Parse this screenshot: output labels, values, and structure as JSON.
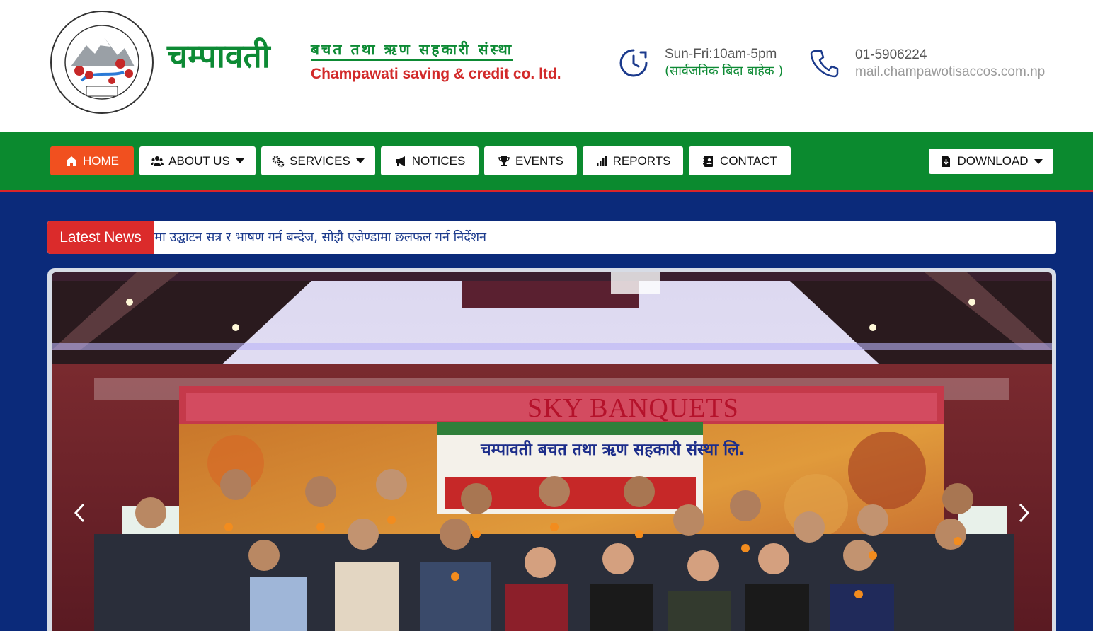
{
  "header": {
    "brand_np": "चम्पावती",
    "brand_sub_np": "बचत तथा ऋण सहकारी संस्था",
    "brand_sub_en": "Champawati saving & credit co. ltd.",
    "logo": {
      "top_text": "चम्पावती बचत तथा ऋण सहकारी संस्था लि.",
      "year": "२०६७",
      "bottom_text": "टोखा-०५, गोंगबु, काठमाडौं"
    },
    "hours_line1": "Sun-Fri:10am-5pm",
    "hours_line2": "(सार्वजनिक बिदा बाहेक )",
    "phone": "01-5906224",
    "email": "mail.champawotisaccos.com.np",
    "icons": [
      "clock-icon",
      "phone-icon"
    ]
  },
  "nav": {
    "items": [
      {
        "label": "HOME",
        "icon": "home-icon"
      },
      {
        "label": "ABOUT US",
        "icon": "users-icon"
      },
      {
        "label": "SERVICES",
        "icon": "gears-icon"
      },
      {
        "label": "NOTICES",
        "icon": "megaphone-icon"
      },
      {
        "label": "EVENTS",
        "icon": "trophy-icon"
      },
      {
        "label": "REPORTS",
        "icon": "chart-icon"
      },
      {
        "label": "CONTACT",
        "icon": "address-book-icon"
      }
    ],
    "download": {
      "label": "DOWNLOAD",
      "icon": "file-download-icon"
    }
  },
  "news": {
    "label": "Latest News",
    "text": "ामा उद्घाटन सत्र र भाषण गर्न बन्देज, सोझै एजेण्डामा छलफल गर्न निर्देशन"
  },
  "slider": {
    "venue_text": "SKY BANQUETS",
    "banner_title": "चम्पावती बचत तथा ऋण सहकारी संस्था लि."
  },
  "colors": {
    "brand_green": "#0b8a2f",
    "brand_red": "#d9252a",
    "nav_active": "#f1501f",
    "main_bg": "#0b2a7a",
    "news_text": "#1b3a8c"
  }
}
